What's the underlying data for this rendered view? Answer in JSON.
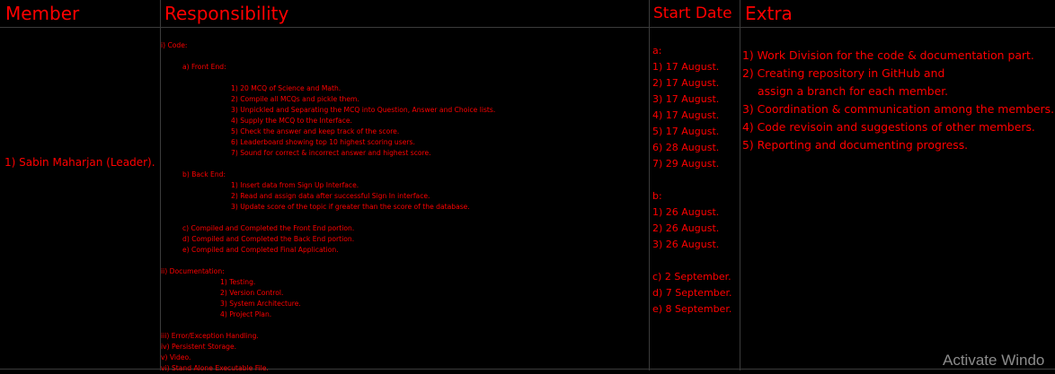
{
  "headers": {
    "member": "Member",
    "responsibility": "Responsibility",
    "start_date": "Start Date",
    "extra": "Extra"
  },
  "row": {
    "member": "1) Sabin Maharjan (Leader).",
    "responsibility_lines": [
      {
        "text": "i) Code:",
        "indent": 0,
        "gap": 0
      },
      {
        "text": "a) Front End:",
        "indent": 1,
        "gap": 1
      },
      {
        "text": "1) 20 MCQ of Science and Math.",
        "indent": 3,
        "gap": 1
      },
      {
        "text": "2) Compile all MCQs and pickle them.",
        "indent": 3,
        "gap": 0
      },
      {
        "text": "3) Unpickled and Separating the MCQ into Question, Answer and Choice lists.",
        "indent": 3,
        "gap": 0
      },
      {
        "text": "4) Supply the MCQ to the Interface.",
        "indent": 3,
        "gap": 0
      },
      {
        "text": "5) Check the answer and keep track of the score.",
        "indent": 3,
        "gap": 0
      },
      {
        "text": "6)  Leaderboard showing top 10 highest scoring users.",
        "indent": 3,
        "gap": 0
      },
      {
        "text": "7)  Sound for correct & incorrect answer and highest score.",
        "indent": 3,
        "gap": 0
      },
      {
        "text": "b) Back End:",
        "indent": 1,
        "gap": 1
      },
      {
        "text": "1) Insert data from Sign Up Interface.",
        "indent": 3,
        "gap": 0
      },
      {
        "text": "2) Read and assign data after successful Sign In interface.",
        "indent": 3,
        "gap": 0
      },
      {
        "text": "3) Update score of the topic if greater than the score of the database.",
        "indent": 3,
        "gap": 0
      },
      {
        "text": "c) Compiled and Completed the Front End portion.",
        "indent": 1,
        "gap": 1
      },
      {
        "text": "d) Compiled and Completed the Back End portion.",
        "indent": 1,
        "gap": 0
      },
      {
        "text": "e) Compiled and Completed Final Application.",
        "indent": 1,
        "gap": 0
      },
      {
        "text": "ii) Documentation:",
        "indent": 0,
        "gap": 1
      },
      {
        "text": "1) Testing.",
        "indent": 2,
        "gap": 0
      },
      {
        "text": "2) Version Control.",
        "indent": 2,
        "gap": 0
      },
      {
        "text": "3) System Architecture.",
        "indent": 2,
        "gap": 0
      },
      {
        "text": "4) Project Plan.",
        "indent": 2,
        "gap": 0
      },
      {
        "text": "iii) Error/Exception Handling.",
        "indent": 0,
        "gap": 1
      },
      {
        "text": "iv) Persistent Storage.",
        "indent": 0,
        "gap": 0
      },
      {
        "text": "v) Video.",
        "indent": 0,
        "gap": 0
      },
      {
        "text": "vi) Stand Alone Executable File.",
        "indent": 0,
        "gap": 0
      }
    ],
    "dates": [
      {
        "text": "a:",
        "gap": 0
      },
      {
        "text": "1) 17 August.",
        "gap": 0
      },
      {
        "text": "2) 17 August.",
        "gap": 0
      },
      {
        "text": "3) 17 August.",
        "gap": 0
      },
      {
        "text": "4) 17 August.",
        "gap": 0
      },
      {
        "text": "5) 17 August.",
        "gap": 0
      },
      {
        "text": "6) 28 August.",
        "gap": 0
      },
      {
        "text": "7) 29 August.",
        "gap": 0
      },
      {
        "text": "b:",
        "gap": 1
      },
      {
        "text": "1) 26 August.",
        "gap": 0
      },
      {
        "text": "2) 26 August.",
        "gap": 0
      },
      {
        "text": "3) 26 August.",
        "gap": 0
      },
      {
        "text": "c)  2 September.",
        "gap": 1
      },
      {
        "text": "d)  7 September.",
        "gap": 0
      },
      {
        "text": "e)  8 September.",
        "gap": 0
      }
    ],
    "extra_lines": [
      {
        "text": "1) Work Division for the code & documentation part.",
        "indent": 0
      },
      {
        "text": "2) Creating repository in GitHub and",
        "indent": 0
      },
      {
        "text": "assign a branch for each member.",
        "indent": 1
      },
      {
        "text": "3) Coordination & communication among the members.",
        "indent": 0
      },
      {
        "text": "4) Code revisoin and suggestions of other members.",
        "indent": 0
      },
      {
        "text": "5) Reporting and documenting progress.",
        "indent": 0
      }
    ]
  },
  "watermark": "Activate Windo",
  "colors": {
    "text": "#ff0000",
    "background": "#000000",
    "grid": "#3b3b3b"
  }
}
